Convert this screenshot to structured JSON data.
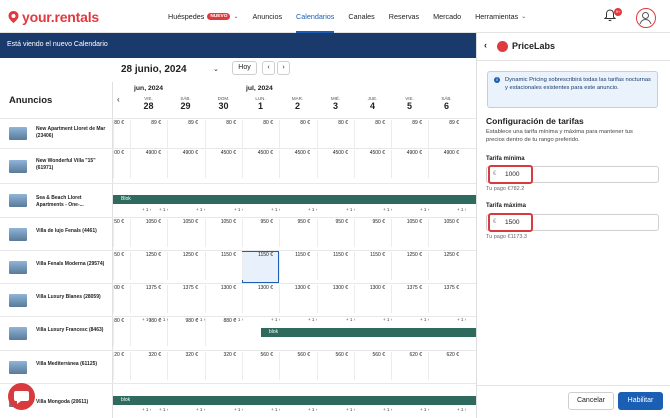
{
  "app": {
    "logo_text": "your.rentals",
    "brand_color": "#e03a3e",
    "accent_color": "#1a5fb4"
  },
  "nav": {
    "items": [
      {
        "label": "Huéspedes",
        "badge": "NUEVO"
      },
      {
        "label": "Anuncios"
      },
      {
        "label": "Calendarios",
        "active": true
      },
      {
        "label": "Canales"
      },
      {
        "label": "Reservas"
      },
      {
        "label": "Mercado"
      },
      {
        "label": "Herramientas"
      }
    ],
    "notif_count": "9+"
  },
  "banner": {
    "text": "Está viendo el nuevo Calendario"
  },
  "calendar": {
    "current_date": "28 junio, 2024",
    "today_button": "Hoy",
    "months": [
      "jun, 2024",
      "jul, 2024"
    ],
    "listings_title": "Anuncios",
    "days": [
      {
        "name": "VIE.",
        "num": "28"
      },
      {
        "name": "SÁB.",
        "num": "29"
      },
      {
        "name": "DOM.",
        "num": "30"
      },
      {
        "name": "LUN.",
        "num": "1"
      },
      {
        "name": "MAR.",
        "num": "2"
      },
      {
        "name": "MIÉ.",
        "num": "3"
      },
      {
        "name": "JUE.",
        "num": "4"
      },
      {
        "name": "VIE.",
        "num": "5"
      },
      {
        "name": "SÁB.",
        "num": "6"
      }
    ],
    "listings": [
      {
        "name": "New Apartment Lloret de Mar (23406)",
        "prices": [
          "80 €",
          "89 €",
          "89 €",
          "80 €",
          "80 €",
          "80 €",
          "80 €",
          "80 €",
          "89 €",
          "89 €"
        ]
      },
      {
        "name": "New Wonderful Villa \"15\" (61971)",
        "prices": [
          "00 €",
          "4900 €",
          "4900 €",
          "4500 €",
          "4500 €",
          "4500 €",
          "4500 €",
          "4500 €",
          "4900 €",
          "4900 €"
        ]
      },
      {
        "name": "Sea & Beach Lloret Apartments - One-...",
        "block": "Blok",
        "subrow": [
          "+ 1 ›",
          "+ 1 ›",
          "+ 1 ›",
          "+ 1 ›",
          "+ 1 ›",
          "+ 1 ›",
          "+ 1 ›",
          "+ 1 ›",
          "+ 1 ›",
          "+ 1 ›"
        ]
      },
      {
        "name": "Villa de lujo Fenals (4461)",
        "prices": [
          "50 €",
          "1050 €",
          "1050 €",
          "1050 €",
          "950 €",
          "950 €",
          "950 €",
          "950 €",
          "1050 €",
          "1050 €"
        ]
      },
      {
        "name": "Villa Fenals Moderna (29574)",
        "prices": [
          "50 €",
          "1250 €",
          "1250 €",
          "1150 €",
          "1150 €",
          "1150 €",
          "1150 €",
          "1150 €",
          "1250 €",
          "1250 €"
        ]
      },
      {
        "name": "Villa Luxury Blanes (28059)",
        "prices": [
          "00 €",
          "1375 €",
          "1375 €",
          "1300 €",
          "1300 €",
          "1300 €",
          "1300 €",
          "1300 €",
          "1375 €",
          "1375 €"
        ]
      },
      {
        "name": "Villa Luxury Francesc (8463)",
        "prices": [
          "80 €",
          "980 €",
          "980 €",
          "880 €"
        ],
        "block": "blok",
        "subrow": [
          "+ 1 ›",
          "+ 1 ›",
          "+ 1 ›",
          "+ 1 ›",
          "+ 1 ›",
          "+ 1 ›",
          "+ 1 ›",
          "+ 1 ›",
          "+ 1 ›",
          "+ 1 ›"
        ]
      },
      {
        "name": "Villa Mediterránea (61125)",
        "prices": [
          "20 €",
          "320 €",
          "320 €",
          "320 €",
          "560 €",
          "560 €",
          "560 €",
          "560 €",
          "620 €",
          "620 €"
        ]
      },
      {
        "name": "Villa Mongoda (20611)",
        "block": "blok",
        "subrow": [
          "+ 1 ›",
          "+ 1 ›",
          "+ 1 ›",
          "+ 1 ›",
          "+ 1 ›",
          "+ 1 ›",
          "+ 1 ›",
          "+ 1 ›",
          "+ 1 ›",
          "+ 1 ›"
        ]
      }
    ]
  },
  "panel": {
    "title": "PriceLabs",
    "info": "Dynamic Pricing sobrescribirá todas las tarifas nocturnas y estacionales existentes para este anuncio.",
    "section_title": "Configuración de tarifas",
    "section_desc": "Establece una tarifa mínima y máxima para mantener tus precios dentro de tu rango preferido.",
    "min_label": "Tarifa mínima",
    "min_value": "1000",
    "min_pay": "Tu pago €782.2",
    "max_label": "Tarifa máxima",
    "max_value": "1500",
    "max_pay": "Tu pago €1173.3",
    "currency": "€",
    "cancel_label": "Cancelar",
    "enable_label": "Habilitar"
  }
}
